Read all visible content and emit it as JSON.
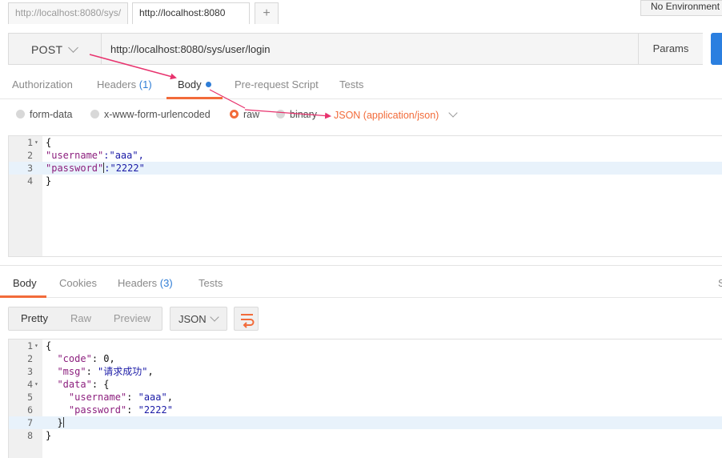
{
  "tabs": [
    {
      "label": "http://localhost:8080/sys/"
    },
    {
      "label": "http://localhost:8080"
    }
  ],
  "new_tab_label": "+",
  "environment": "No Environment",
  "request": {
    "method": "POST",
    "url": "http://localhost:8080/sys/user/login",
    "params_label": "Params"
  },
  "request_tabs": {
    "authorization": "Authorization",
    "headers": "Headers",
    "headers_count": "(1)",
    "body": "Body",
    "prerequest": "Pre-request Script",
    "tests": "Tests"
  },
  "body_modes": {
    "form_data": "form-data",
    "urlencoded": "x-www-form-urlencoded",
    "raw": "raw",
    "binary": "binary",
    "content_type": "JSON (application/json)"
  },
  "request_body_lines": [
    "1",
    "2",
    "3",
    "4"
  ],
  "request_body": {
    "l1": "{",
    "l2_key": "\"username\"",
    "l2_rest": ":\"aaa\",",
    "l3_key": "\"password\"",
    "l3_rest": ":\"2222\"",
    "l4": "}"
  },
  "response_tabs": {
    "body": "Body",
    "cookies": "Cookies",
    "headers": "Headers",
    "headers_count": "(3)",
    "tests": "Tests",
    "side": "S"
  },
  "response_formats": {
    "pretty": "Pretty",
    "raw": "Raw",
    "preview": "Preview",
    "type": "JSON"
  },
  "response_body_lines": [
    "1",
    "2",
    "3",
    "4",
    "5",
    "6",
    "7",
    "8"
  ],
  "response_body": {
    "l1": "{",
    "l2_key": "\"code\"",
    "l2_val": "0",
    "l3_key": "\"msg\"",
    "l3_val": "\"请求成功\"",
    "l4_key": "\"data\"",
    "l4_rest": "{",
    "l5_key": "\"username\"",
    "l5_val": "\"aaa\"",
    "l6_key": "\"password\"",
    "l6_val": "\"2222\"",
    "l7": "}",
    "l8": "}"
  },
  "colors": {
    "accent": "#f26b3a",
    "annotation_arrow": "#e8336e",
    "count_blue": "#2f7dd6",
    "send_blue": "#2b7fe0",
    "key_purple": "#8c1f7e",
    "string_blue": "#1a1aa6",
    "highlight_line": "#e8f2fb"
  }
}
